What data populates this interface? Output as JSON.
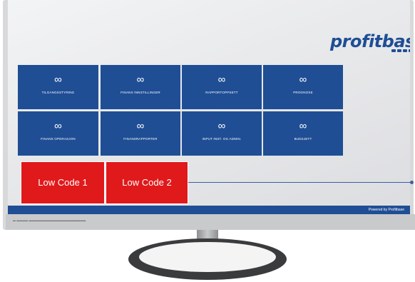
{
  "brand": {
    "logo_text": "profitbase"
  },
  "tiles": [
    {
      "label": "TILGANGSSTYRING",
      "icon": "infinity-icon"
    },
    {
      "label": "FINANS INNSTILLINGER",
      "icon": "infinity-icon"
    },
    {
      "label": "RAPPORTOPPSETT",
      "icon": "infinity-icon"
    },
    {
      "label": "PROGNOSE",
      "icon": "infinity-icon"
    },
    {
      "label": "FINANS OPERASJON",
      "icon": "infinity-icon"
    },
    {
      "label": "FINANSRAPPORTER",
      "icon": "infinity-icon"
    },
    {
      "label": "INPUT INST. OG ADMIN.",
      "icon": "infinity-icon"
    },
    {
      "label": "BUDSJETT",
      "icon": "infinity-icon"
    }
  ],
  "icon_glyph": "∞",
  "low_code": [
    {
      "label": "Low Code 1"
    },
    {
      "label": "Low Code 2"
    }
  ],
  "footer": {
    "powered": "Powered by Profitbase"
  },
  "colors": {
    "tile": "#1f4e95",
    "accent": "#e0191b",
    "footer": "#1f4e95"
  }
}
